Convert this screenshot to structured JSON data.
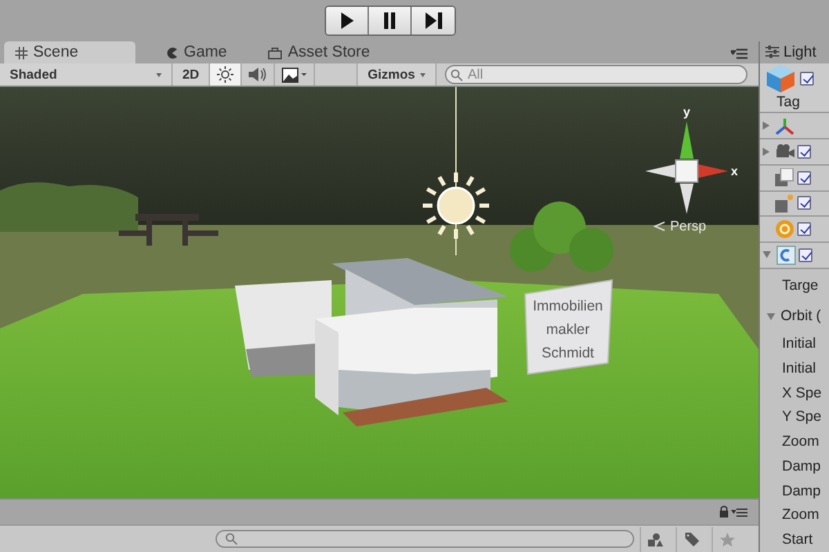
{
  "playback": [
    {
      "kind": "play"
    },
    {
      "kind": "pause"
    },
    {
      "kind": "step"
    }
  ],
  "tabs": [
    {
      "label": "Scene",
      "kind": "scene",
      "selected": true
    },
    {
      "label": "Game",
      "kind": "game",
      "selected": false
    },
    {
      "label": "Asset Store",
      "kind": "store",
      "selected": false
    }
  ],
  "scene_toolbar": {
    "shading": "Shaded",
    "mode_2d": "2D",
    "toggles": [
      {
        "kind": "lighting",
        "on": true
      },
      {
        "kind": "audio",
        "on": false
      },
      {
        "kind": "effects",
        "on": false
      }
    ],
    "gizmos": "Gizmos",
    "search_placeholder": "All"
  },
  "viewport": {
    "axis_labels": [
      "y",
      "x"
    ],
    "persp_label": "Persp",
    "sign_lines": [
      "Immobilien",
      "makler",
      "Schmidt"
    ]
  },
  "inspector": {
    "tab": "Light",
    "tag_label": "Tag",
    "enabled": true,
    "components": [
      {
        "kind": "transform",
        "expanded": false
      },
      {
        "kind": "camera",
        "expanded": false,
        "checked": true
      },
      {
        "kind": "layer",
        "checked": true
      },
      {
        "kind": "flare",
        "checked": true
      },
      {
        "kind": "audio",
        "checked": true
      },
      {
        "kind": "script",
        "expanded": true,
        "checked": true
      }
    ],
    "target_label": "Targe",
    "section": {
      "label": "Orbit (",
      "expanded": true
    },
    "fields": [
      "Initial",
      "Initial",
      "X Spe",
      "Y Spe",
      "Zoom",
      "Damp",
      "Damp",
      "Zoom",
      "Start"
    ]
  }
}
